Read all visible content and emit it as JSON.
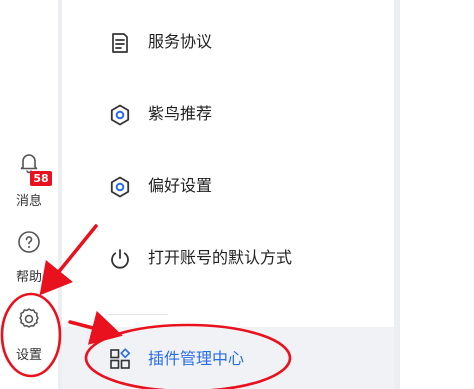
{
  "rail": {
    "messages": {
      "label": "消息",
      "badge": "58",
      "icon": "bell-icon"
    },
    "help": {
      "label": "帮助",
      "icon": "question-circle-icon"
    },
    "settings": {
      "label": "设置",
      "icon": "gear-icon"
    }
  },
  "menu": {
    "items": [
      {
        "label": "服务协议",
        "icon": "document-icon"
      },
      {
        "label": "紫鸟推荐",
        "icon": "hexagon-icon"
      },
      {
        "label": "偏好设置",
        "icon": "hexagon-icon"
      },
      {
        "label": "打开账号的默认方式",
        "icon": "power-icon"
      },
      {
        "label": "插件管理中心",
        "icon": "apps-icon",
        "active": true
      }
    ]
  },
  "colors": {
    "annotation_red": "#e8111d",
    "active_blue": "#2b6de8",
    "active_bg": "#f0f2f6"
  }
}
